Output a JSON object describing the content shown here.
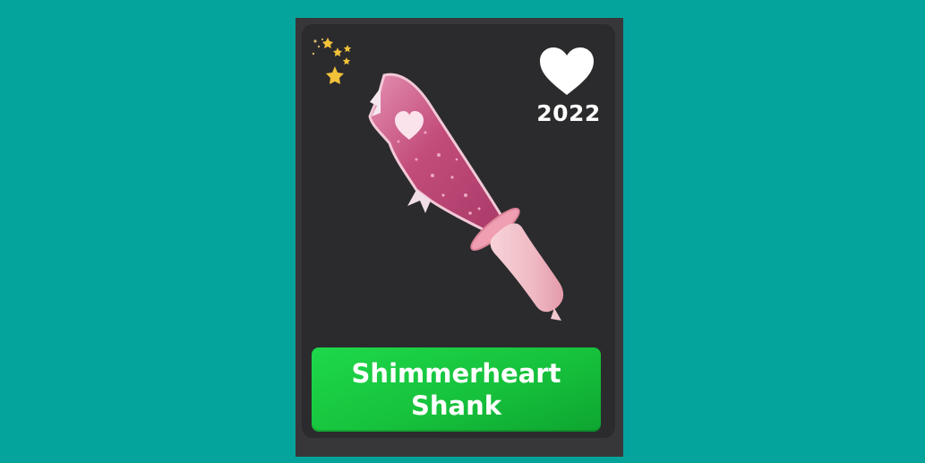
{
  "card": {
    "item_name_line1": "Shimmerheart",
    "item_name_line2": "Shank",
    "year": "2022",
    "favorite_icon": "heart-icon",
    "rarity_icon": "sparkle-stars-icon",
    "colors": {
      "background": "#04a49c",
      "card": "#2b2b2d",
      "banner": "#16c23c",
      "blade": "#c8507f",
      "handle": "#f2c3cb"
    }
  }
}
